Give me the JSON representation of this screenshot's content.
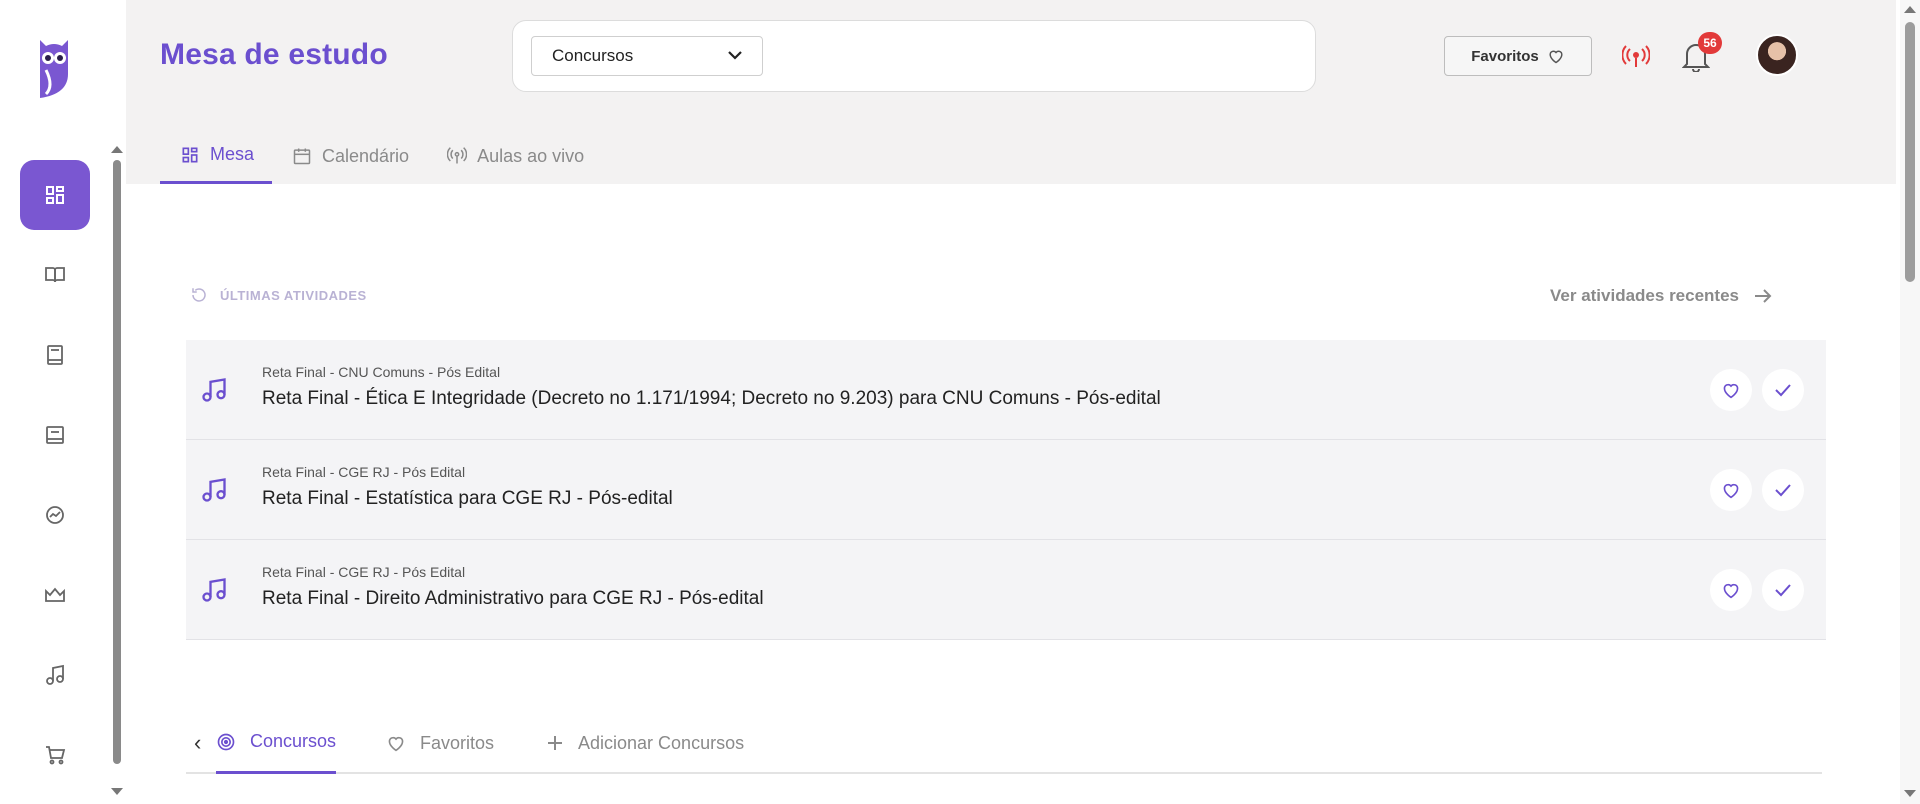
{
  "sidebar": {
    "items": [
      {
        "icon": "dashboard-icon",
        "active": true
      },
      {
        "icon": "book-open-icon",
        "active": false
      },
      {
        "icon": "book-icon",
        "active": false
      },
      {
        "icon": "notebook-icon",
        "active": false
      },
      {
        "icon": "chart-icon",
        "active": false
      },
      {
        "icon": "crown-icon",
        "active": false
      },
      {
        "icon": "music-note-icon",
        "active": false
      },
      {
        "icon": "cart-icon",
        "active": false
      }
    ]
  },
  "header": {
    "title": "Mesa de estudo",
    "select_value": "Concursos",
    "favorites_label": "Favoritos",
    "notification_count": "56"
  },
  "tabs": [
    {
      "label": "Mesa",
      "icon": "grid-icon",
      "active": true
    },
    {
      "label": "Calendário",
      "icon": "calendar-icon",
      "active": false
    },
    {
      "label": "Aulas ao vivo",
      "icon": "broadcast-icon",
      "active": false
    }
  ],
  "activities": {
    "heading": "ÚLTIMAS ATIVIDADES",
    "see_recent_label": "Ver atividades recentes",
    "items": [
      {
        "subtitle": "Reta Final - CNU Comuns - Pós Edital",
        "title": "Reta Final - Ética E Integridade (Decreto no 1.171/1994; Decreto no 9.203) para CNU Comuns - Pós-edital"
      },
      {
        "subtitle": "Reta Final - CGE RJ - Pós Edital",
        "title": "Reta Final - Estatística para CGE RJ - Pós-edital"
      },
      {
        "subtitle": "Reta Final - CGE RJ - Pós Edital",
        "title": "Reta Final - Direito Administrativo para CGE RJ - Pós-edital"
      }
    ]
  },
  "bottom_tabs": [
    {
      "label": "Concursos",
      "icon": "target-icon",
      "active": true
    },
    {
      "label": "Favoritos",
      "icon": "heart-icon",
      "active": false
    },
    {
      "label": "Adicionar Concursos",
      "icon": "plus-icon",
      "active": false
    }
  ],
  "colors": {
    "accent": "#6b4fcf",
    "badge": "#e23a3a",
    "live": "#e23a3a"
  }
}
